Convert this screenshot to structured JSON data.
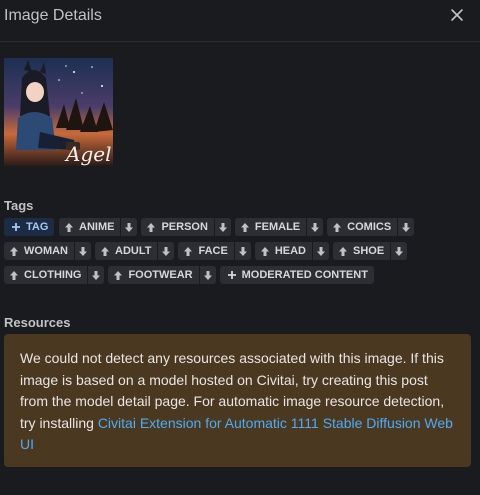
{
  "modal": {
    "title": "Image Details"
  },
  "image": {
    "caption": "Agel"
  },
  "tags": {
    "label": "Tags",
    "add_label": "TAG",
    "rows": [
      [
        "ANIME",
        "PERSON",
        "FEMALE",
        "COMICS"
      ],
      [
        "WOMAN",
        "ADULT",
        "FACE",
        "HEAD",
        "SHOE"
      ],
      [
        "CLOTHING",
        "FOOTWEAR"
      ]
    ],
    "moderated_label": "MODERATED CONTENT"
  },
  "resources": {
    "label": "Resources",
    "message": "We could not detect any resources associated with this image. If this image is based on a model hosted on Civitai, try creating this post from the model detail page. For automatic image resource detection, try installing ",
    "link_text": "Civitai Extension for Automatic 1111 Stable Diffusion Web UI"
  },
  "colors": {
    "background": "#1a1b1e",
    "tag_bg": "#2c2e33",
    "alert_bg": "#4a3821",
    "link": "#4dabf7"
  }
}
